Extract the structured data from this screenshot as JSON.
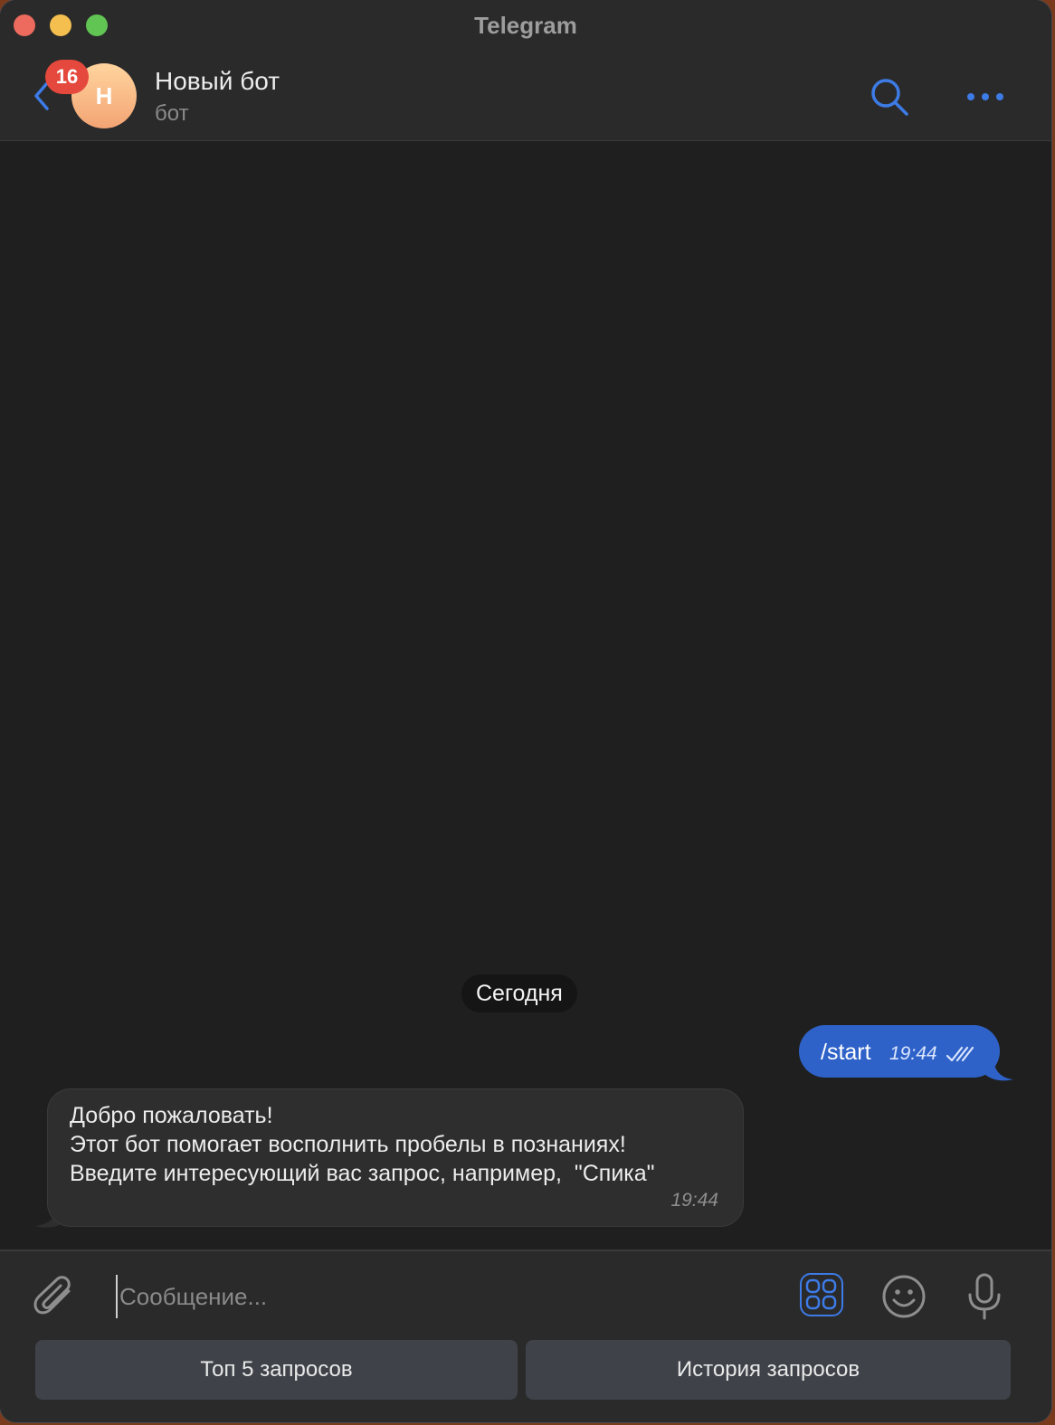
{
  "window": {
    "title": "Telegram"
  },
  "header": {
    "unread_count": "16",
    "avatar_initial": "Н",
    "chat_name": "Новый бот",
    "chat_status": "бот",
    "accent_color": "#3d7be6"
  },
  "chat": {
    "date_separator": "Сегодня",
    "outgoing": {
      "text": "/start",
      "time": "19:44",
      "status": "read"
    },
    "incoming": {
      "lines": [
        "Добро пожаловать!",
        "Этот бот помогает восполнить пробелы в познаниях!",
        "Введите интересующий вас запрос, например,  \"Спика\""
      ],
      "time": "19:44"
    }
  },
  "composer": {
    "placeholder": "Сообщение...",
    "value": ""
  },
  "bot_keyboard": {
    "buttons": [
      "Топ 5 запросов",
      "История запросов"
    ]
  },
  "icons": {
    "back": "chevron-left-icon",
    "search": "search-icon",
    "more": "more-dots-icon",
    "attach": "paperclip-icon",
    "bot_keyboard": "bot-keyboard-icon",
    "emoji": "emoji-icon",
    "mic": "microphone-icon"
  }
}
